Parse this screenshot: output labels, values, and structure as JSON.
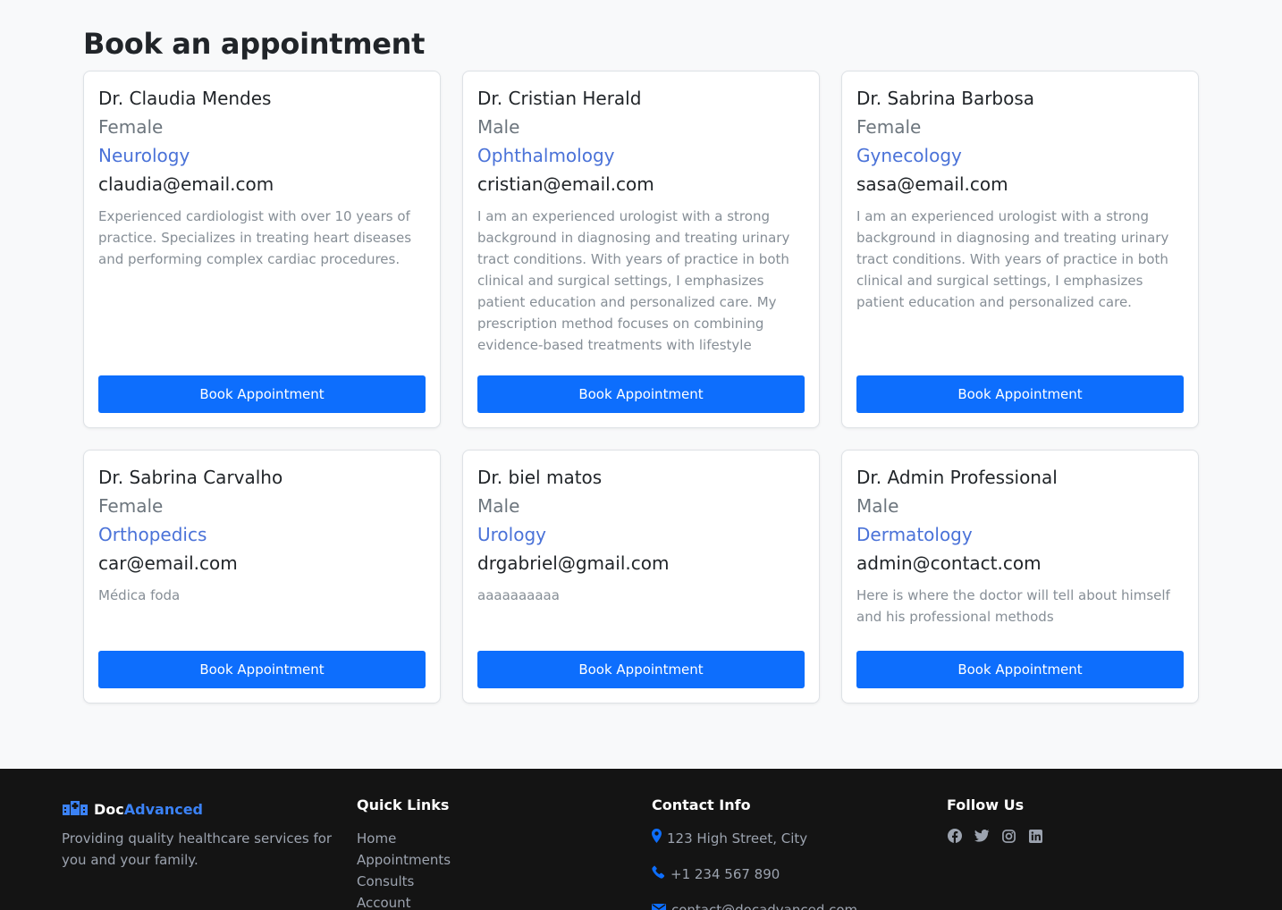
{
  "page": {
    "title": "Book an appointment"
  },
  "doctors": [
    {
      "name": "Dr. Claudia Mendes",
      "gender": "Female",
      "specialty": "Neurology",
      "email": "claudia@email.com",
      "bio": "Experienced cardiologist with over 10 years of practice. Specializes in treating heart diseases and performing complex cardiac procedures.",
      "button": "Book Appointment"
    },
    {
      "name": "Dr. Cristian Herald",
      "gender": "Male",
      "specialty": "Ophthalmology",
      "email": "cristian@email.com",
      "bio": "I am an experienced urologist with a strong background in diagnosing and treating urinary tract conditions. With years of practice in both clinical and surgical settings, I emphasizes patient education and personalized care. My prescription method focuses on combining evidence-based treatments with lifestyle adjustments to improve",
      "button": "Book Appointment"
    },
    {
      "name": "Dr. Sabrina Barbosa",
      "gender": "Female",
      "specialty": "Gynecology",
      "email": "sasa@email.com",
      "bio": "I am an experienced urologist with a strong background in diagnosing and treating urinary tract conditions. With years of practice in both clinical and surgical settings, I emphasizes patient education and personalized care.",
      "button": "Book Appointment"
    },
    {
      "name": "Dr. Sabrina Carvalho",
      "gender": "Female",
      "specialty": "Orthopedics",
      "email": "car@email.com",
      "bio": "Médica foda",
      "button": "Book Appointment"
    },
    {
      "name": "Dr. biel matos",
      "gender": "Male",
      "specialty": "Urology",
      "email": "drgabriel@gmail.com",
      "bio": "aaaaaaaaaa",
      "button": "Book Appointment"
    },
    {
      "name": "Dr. Admin Professional",
      "gender": "Male",
      "specialty": "Dermatology",
      "email": "admin@contact.com",
      "bio": "Here is where the doctor will tell about himself and his professional methods",
      "button": "Book Appointment"
    }
  ],
  "footer": {
    "brand_doc": "Doc",
    "brand_advanced": "Advanced",
    "tagline": "Providing quality healthcare services for you and your family.",
    "quick_links_title": "Quick Links",
    "quick_links": [
      "Home",
      "Appointments",
      "Consults",
      "Account"
    ],
    "contact_title": "Contact Info",
    "address": "123 High Street, City",
    "phone": "+1 234 567 890",
    "email": "contact@docadvanced.com",
    "follow_title": "Follow Us",
    "social_icons": [
      "facebook-icon",
      "twitter-icon",
      "instagram-icon",
      "linkedin-icon"
    ]
  },
  "colors": {
    "primary": "#0d6efd",
    "specialty": "#4a72d8",
    "footer_bg": "#141414"
  }
}
